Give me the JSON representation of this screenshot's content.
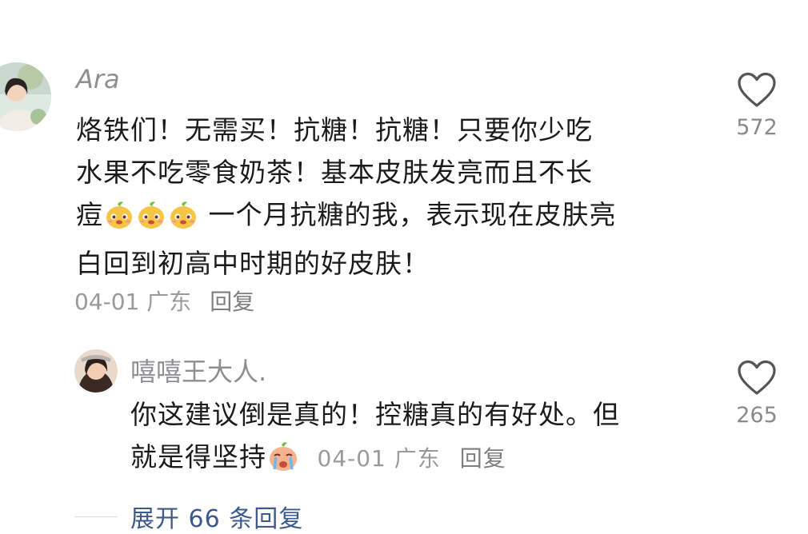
{
  "comment": {
    "username": "Ara",
    "text_line1": "烙铁们！无需买！抗糖！抗糖！只要你少吃",
    "text_line2": "水果不吃零食奶茶！基本皮肤发亮而且不长",
    "text_line3_start": "痘",
    "text_line3_end": " 一个月抗糖的我，表示现在皮肤亮",
    "text_line4": "白回到初高中时期的好皮肤！",
    "date": "04-01",
    "location": "广东",
    "reply_label": "回复",
    "likes": "572",
    "emoji_name": "cheeky-orange-emoji"
  },
  "reply": {
    "username": "嘻嘻王大人.",
    "text_line1": "你这建议倒是真的！控糖真的有好处。但",
    "text_line2": "就是得坚持",
    "date": "04-01",
    "location": "广东",
    "reply_label": "回复",
    "likes": "265",
    "emoji_name": "crying-orange-emoji"
  },
  "expand_label": "展开 66 条回复",
  "colors": {
    "username": "#8e8e93",
    "text": "#1b1b1b",
    "meta": "#9a9a9a",
    "link": "#3d5a8c"
  }
}
